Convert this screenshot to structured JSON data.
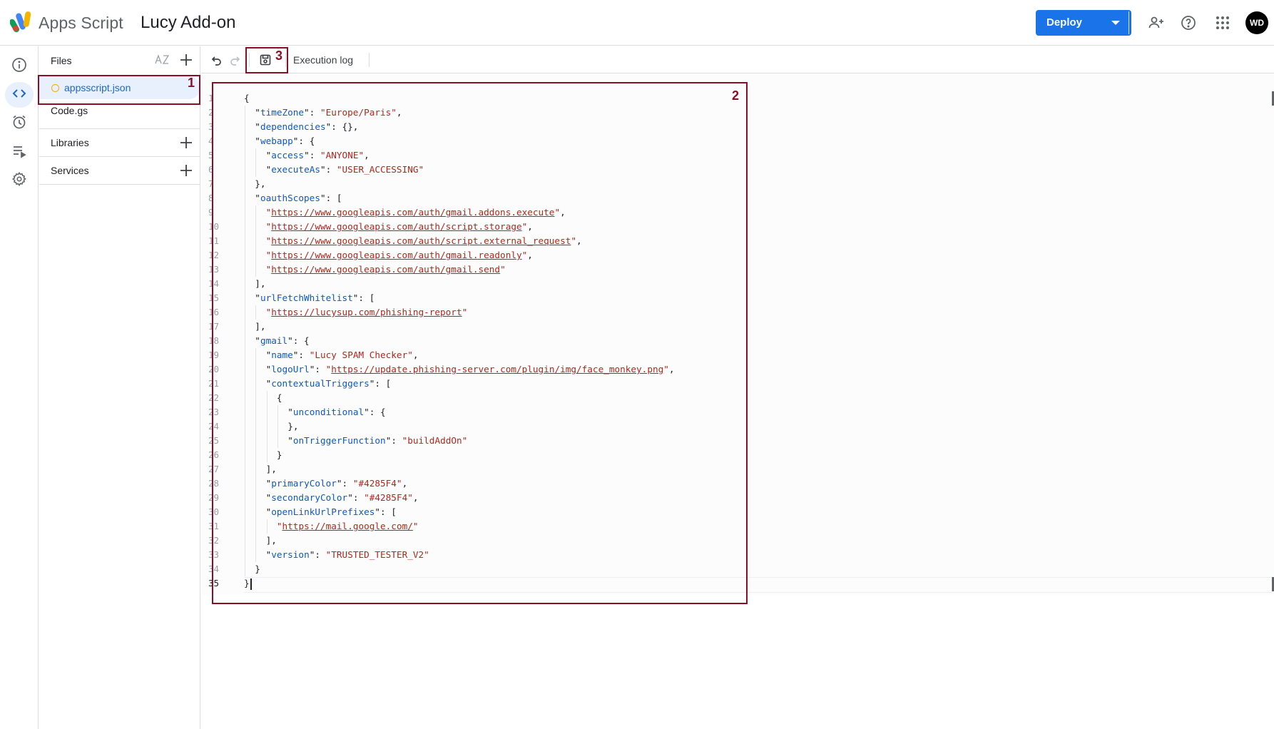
{
  "header": {
    "product_name": "Apps Script",
    "project_title": "Lucy Add-on",
    "deploy_label": "Deploy",
    "avatar_initials": "WD",
    "accent_color": "#1a73e8"
  },
  "rail": {
    "items": [
      {
        "name": "overview",
        "icon": "info-icon"
      },
      {
        "name": "editor",
        "icon": "code-icon",
        "active": true
      },
      {
        "name": "triggers",
        "icon": "alarm-clock-icon"
      },
      {
        "name": "executions",
        "icon": "executions-list-icon"
      },
      {
        "name": "project-settings",
        "icon": "gear-icon"
      }
    ]
  },
  "files": {
    "title": "Files",
    "sort_label": "AZ",
    "items": [
      {
        "label": "appsscript.json",
        "active": true,
        "unsaved": true
      },
      {
        "label": "Code.gs",
        "active": false,
        "unsaved": false
      }
    ],
    "libraries_label": "Libraries",
    "services_label": "Services"
  },
  "toolbar": {
    "execution_log_label": "Execution log"
  },
  "editor": {
    "current_line": 35,
    "lines": [
      "{",
      "  \"timeZone\": \"Europe/Paris\",",
      "  \"dependencies\": {},",
      "  \"webapp\": {",
      "    \"access\": \"ANYONE\",",
      "    \"executeAs\": \"USER_ACCESSING\"",
      "  },",
      "  \"oauthScopes\": [",
      "    \"https://www.googleapis.com/auth/gmail.addons.execute\",",
      "    \"https://www.googleapis.com/auth/script.storage\",",
      "    \"https://www.googleapis.com/auth/script.external_request\",",
      "    \"https://www.googleapis.com/auth/gmail.readonly\",",
      "    \"https://www.googleapis.com/auth/gmail.send\"",
      "  ],",
      "  \"urlFetchWhitelist\": [",
      "    \"https://lucysup.com/phishing-report\"",
      "  ],",
      "  \"gmail\": {",
      "    \"name\": \"Lucy SPAM Checker\",",
      "    \"logoUrl\": \"https://update.phishing-server.com/plugin/img/face_monkey.png\",",
      "    \"contextualTriggers\": [",
      "      {",
      "        \"unconditional\": {",
      "        },",
      "        \"onTriggerFunction\": \"buildAddOn\"",
      "      }",
      "    ],",
      "    \"primaryColor\": \"#4285F4\",",
      "    \"secondaryColor\": \"#4285F4\",",
      "    \"openLinkUrlPrefixes\": [",
      "      \"https://mail.google.com/\"",
      "    ],",
      "    \"version\": \"TRUSTED_TESTER_V2\"",
      "  }",
      "}"
    ]
  },
  "annotations": {
    "color": "#8b0e26",
    "labels": [
      "1",
      "2",
      "3"
    ]
  }
}
